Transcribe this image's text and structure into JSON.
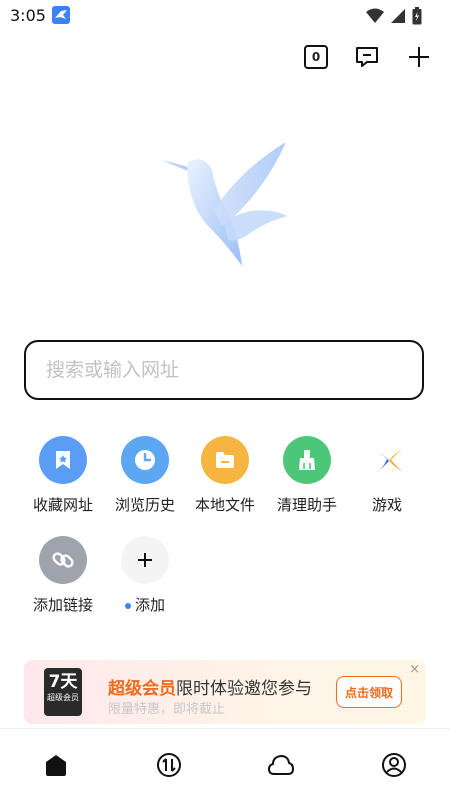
{
  "status_bar": {
    "time": "3:05",
    "app_icon": "bird-notification-icon",
    "icons": [
      "wifi-icon",
      "signal-icon",
      "battery-icon"
    ]
  },
  "toolbar": {
    "tab_count": "0",
    "icons": [
      "tabs-icon",
      "message-icon",
      "add-icon"
    ]
  },
  "logo": {
    "icon": "hummingbird-logo"
  },
  "search": {
    "placeholder": "搜索或输入网址"
  },
  "shortcuts": [
    {
      "label": "收藏网址",
      "icon": "bookmark-icon",
      "color": "#5b9cf5"
    },
    {
      "label": "浏览历史",
      "icon": "clock-icon",
      "color": "#5ca6f2"
    },
    {
      "label": "本地文件",
      "icon": "folder-icon",
      "color": "#f6b540"
    },
    {
      "label": "清理助手",
      "icon": "broom-icon",
      "color": "#4cc77a"
    },
    {
      "label": "游戏",
      "icon": "game-x-icon",
      "color": "#ffffff"
    },
    {
      "label": "添加链接",
      "icon": "link-icon",
      "color": "#9ea3ad"
    },
    {
      "label": "添加",
      "icon": "plus-icon",
      "color": "#f4f4f4"
    }
  ],
  "promo": {
    "badge_big": "7天",
    "badge_small": "超级会员",
    "title_accent": "超级会员",
    "title_rest": "限时体验邀您参与",
    "subtitle": "限量特惠，即将截止",
    "button": "点击领取",
    "close": "×",
    "accent_color": "#f26b1d"
  },
  "bottom_nav": {
    "items": [
      "home-icon",
      "transfer-icon",
      "cloud-icon",
      "profile-icon"
    ]
  }
}
